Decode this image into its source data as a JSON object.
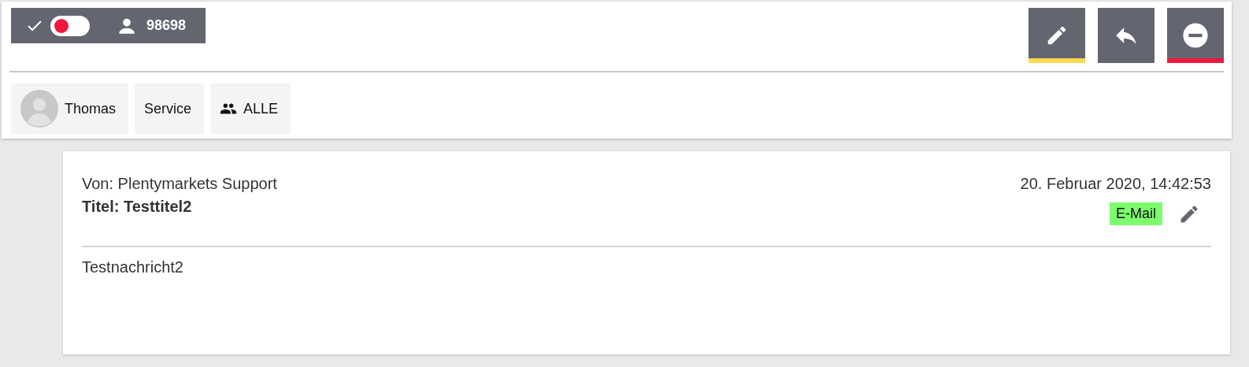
{
  "status": {
    "toggle": {
      "on": false
    },
    "user_id": "98698"
  },
  "actions": [
    {
      "kind": "edit",
      "color": "#ffd84d"
    },
    {
      "kind": "reply"
    },
    {
      "kind": "remove",
      "color": "#f0193d"
    }
  ],
  "chips": [
    {
      "kind": "avatar",
      "label": "Thomas"
    },
    {
      "kind": "plain",
      "label": "Service"
    },
    {
      "kind": "group",
      "label": "ALLE"
    }
  ],
  "message": {
    "from": "Von: Plentymarkets Support",
    "title": "Titel: Testtitel2",
    "date": "20. Februar 2020, 14:42:53",
    "channel": {
      "label": "E-Mail",
      "color": "#7dfc6e"
    },
    "body": "Testnachricht2"
  }
}
